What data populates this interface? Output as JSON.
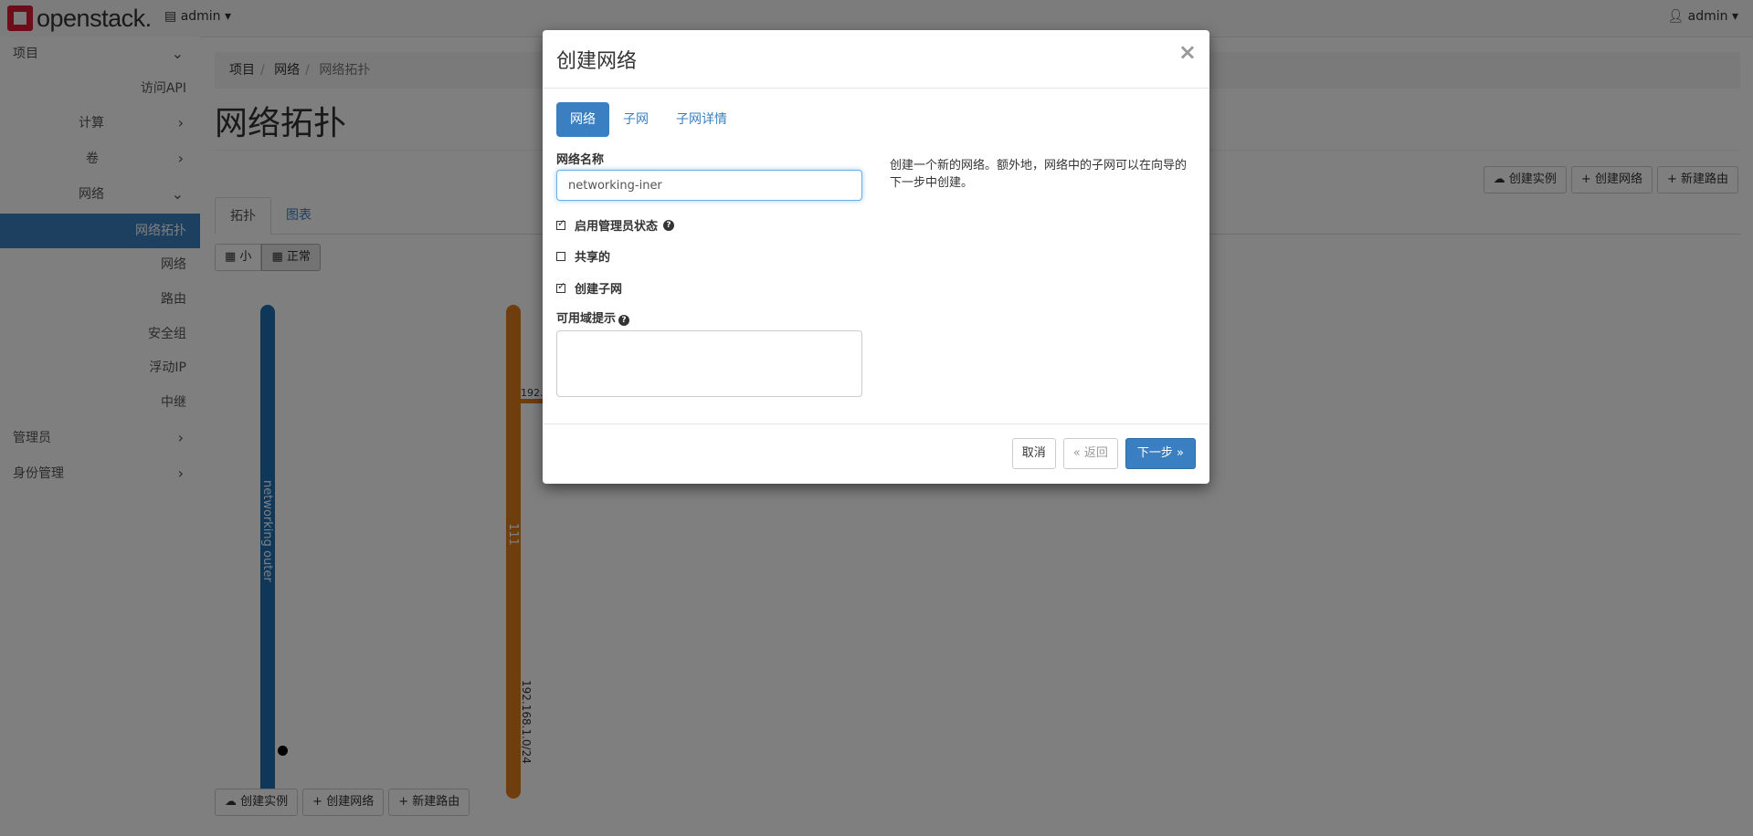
{
  "header": {
    "logo_text": "openstack.",
    "project_dropdown": "admin",
    "user_dropdown": "admin"
  },
  "sidebar": {
    "items": [
      {
        "label": "项目",
        "chevron": "down"
      },
      {
        "label": "访问API"
      },
      {
        "label": "计算",
        "chevron": "right"
      },
      {
        "label": "卷",
        "chevron": "right"
      },
      {
        "label": "网络",
        "chevron": "down"
      },
      {
        "label": "网络拓扑",
        "active": true
      },
      {
        "label": "网络"
      },
      {
        "label": "路由"
      },
      {
        "label": "安全组"
      },
      {
        "label": "浮动IP"
      },
      {
        "label": "中继"
      },
      {
        "label": "管理员",
        "chevron": "right"
      },
      {
        "label": "身份管理",
        "chevron": "right"
      }
    ]
  },
  "breadcrumb": [
    "项目",
    "网络",
    "网络拓扑"
  ],
  "page_title": "网络拓扑",
  "top_actions": {
    "create_instance": "创建实例",
    "create_network": "创建网络",
    "create_router": "新建路由"
  },
  "tabs": [
    "拓扑",
    "图表"
  ],
  "view_toggle": {
    "small": "小",
    "normal": "正常"
  },
  "topology": {
    "networks": [
      {
        "name": "networking outer",
        "color": "#1f6fb3"
      },
      {
        "name": "111",
        "subnet": "192.168.1.0/24",
        "color": "#e07b1a",
        "partial_label": "192."
      }
    ]
  },
  "bottom_actions": {
    "create_instance": "创建实例",
    "create_network": "创建网络",
    "create_router": "新建路由"
  },
  "modal": {
    "title": "创建网络",
    "close": "×",
    "wizard_tabs": [
      "网络",
      "子网",
      "子网详情"
    ],
    "network_name_label": "网络名称",
    "network_name_value": "networking-iner",
    "admin_state_label": "启用管理员状态",
    "shared_label": "共享的",
    "create_subnet_label": "创建子网",
    "az_hint_label": "可用域提示",
    "help_text": "创建一个新的网络。额外地，网络中的子网可以在向导的下一步中创建。",
    "cancel": "取消",
    "back": "返回",
    "next": "下一步"
  }
}
